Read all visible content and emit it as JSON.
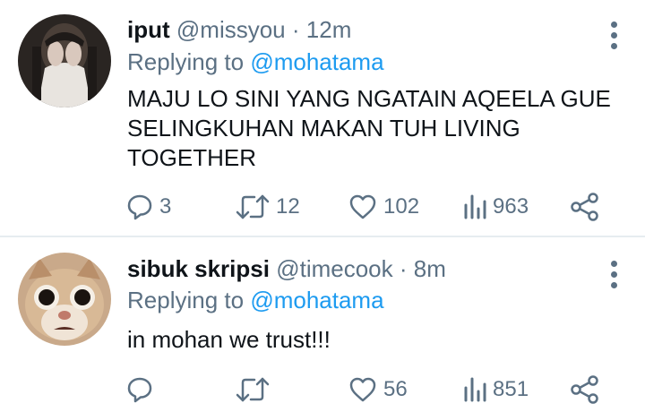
{
  "tweets": [
    {
      "name": "iput",
      "handle": "@missyou",
      "separator": "·",
      "time": "12m",
      "reply_prefix": "Replying to",
      "reply_mention": "@mohatama",
      "text": "MAJU LO SINI YANG NGATAIN AQEELA GUE SELINGKUHAN MAKAN TUH LIVING TOGETHER",
      "replies": "3",
      "retweets": "12",
      "likes": "102",
      "views": "963"
    },
    {
      "name": "sibuk skripsi",
      "handle": "@timecook",
      "separator": "·",
      "time": "8m",
      "reply_prefix": "Replying to",
      "reply_mention": "@mohatama",
      "text": "in mohan we trust!!!",
      "replies": "",
      "retweets": "",
      "likes": "56",
      "views": "851"
    }
  ],
  "icons": {
    "reply": "reply-icon",
    "retweet": "retweet-icon",
    "like": "heart-icon",
    "views": "views-icon",
    "share": "share-icon",
    "more": "more-vertical-icon"
  },
  "colors": {
    "text": "#0f1419",
    "secondary": "#5b7083",
    "mention": "#1d9bf0",
    "divider": "#e6ecf0"
  }
}
